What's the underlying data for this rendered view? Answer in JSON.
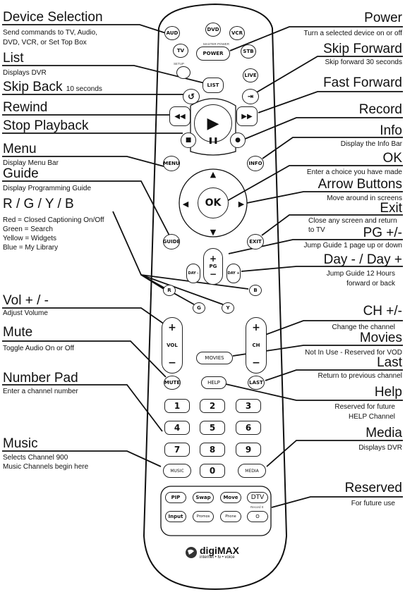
{
  "left": {
    "device": {
      "title": "Device Selection",
      "sub1": "Send commands to TV, Audio,",
      "sub2": "DVD, VCR, or Set Top Box"
    },
    "list": {
      "title": "List",
      "sub": "Displays DVR"
    },
    "skip_back": {
      "title": "Skip Back",
      "note": "10 seconds"
    },
    "rewind": {
      "title": "Rewind"
    },
    "stop": {
      "title": "Stop Playback"
    },
    "menu": {
      "title": "Menu",
      "sub": "Display Menu Bar"
    },
    "guide": {
      "title": "Guide",
      "sub": "Display Programming Guide"
    },
    "rgyb": {
      "title": "R / G / Y / B",
      "lines": [
        "Red = Closed Captioning On/Off",
        "Green = Search",
        "Yellow = Widgets",
        "Blue = My Library"
      ]
    },
    "vol": {
      "title": "Vol + / -",
      "sub": "Adjust Volume"
    },
    "mute": {
      "title": "Mute",
      "sub": "Toggle Audio On or Off"
    },
    "numpad": {
      "title": "Number Pad",
      "sub": "Enter a channel number"
    },
    "music": {
      "title": "Music",
      "sub1": "Selects Channel 900",
      "sub2": "Music Channels begin here"
    }
  },
  "right": {
    "power": {
      "title": "Power",
      "sub": "Turn a selected device on or off"
    },
    "skip_fwd": {
      "title": "Skip Forward",
      "sub": "Skip forward 30 seconds"
    },
    "ff": {
      "title": "Fast Forward"
    },
    "record": {
      "title": "Record"
    },
    "info": {
      "title": "Info",
      "sub": "Display the Info Bar"
    },
    "ok": {
      "title": "OK",
      "sub": "Enter a choice you have made"
    },
    "arrows": {
      "title": "Arrow Buttons",
      "sub": "Move around in screens"
    },
    "exit": {
      "title": "Exit",
      "sub1": "Close any screen and return",
      "sub2": "to TV"
    },
    "pg": {
      "title": "PG +/-",
      "sub": "Jump Guide 1 page up or down"
    },
    "day": {
      "title": "Day - / Day +",
      "sub1": "Jump Guide 12 Hours",
      "sub2": "forward or back"
    },
    "ch": {
      "title": "CH +/-",
      "sub": "Change the channel"
    },
    "movies": {
      "title": "Movies",
      "sub": "Not In Use - Reserved for VOD"
    },
    "last": {
      "title": "Last",
      "sub": "Return to previous channel"
    },
    "help": {
      "title": "Help",
      "sub1": "Reserved for future",
      "sub2": "HELP Channel"
    },
    "media": {
      "title": "Media",
      "sub": "Displays DVR"
    },
    "reserved": {
      "title": "Reserved",
      "sub": "For future use"
    }
  },
  "remote": {
    "aud": "AUD",
    "dvd": "DVD",
    "vcr": "VCR",
    "tv": "TV",
    "power": "POWER",
    "master_power": "MASTER POWER",
    "stb": "STB",
    "setup": "SETUP",
    "list": "LIST",
    "live": "LIVE",
    "menu": "MENU",
    "info": "INFO",
    "ok": "OK",
    "guide": "GUIDE",
    "exit": "EXIT",
    "pg": "PG",
    "day_minus": "DAY -",
    "day_plus": "DAY +",
    "r": "R",
    "g": "G",
    "y": "Y",
    "b": "B",
    "vol": "VOL",
    "ch": "CH",
    "plus": "+",
    "minus": "−",
    "movies": "MOVIES",
    "mute": "MUTE",
    "help": "HELP",
    "last": "LAST",
    "keys": [
      "1",
      "2",
      "3",
      "4",
      "5",
      "6",
      "7",
      "8",
      "9"
    ],
    "music": "MUSIC",
    "zero": "0",
    "media": "MEDIA",
    "pip": "PIP",
    "swap": "Swap",
    "move": "Move",
    "dtv": "DTV",
    "input": "Input",
    "promos": "Promos",
    "phone": "Phone",
    "record_label": "Record It",
    "o": "O",
    "logo": "digiMAX",
    "tagline": "internet • tv • voice"
  }
}
